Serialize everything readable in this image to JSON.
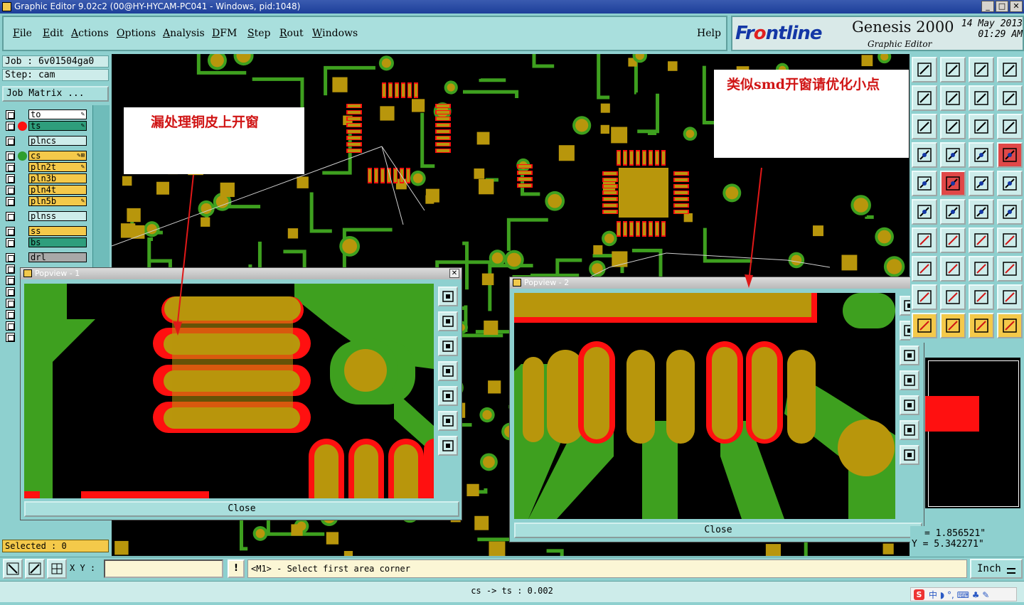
{
  "window": {
    "title": "Graphic Editor 9.02c2 (00@HY-HYCAM-PC041 - Windows, pid:1048)",
    "buttons": [
      "_",
      "□",
      "✕"
    ]
  },
  "menu": {
    "items": [
      "File",
      "Edit",
      "Actions",
      "Options",
      "Analysis",
      "DFM",
      "Step",
      "Rout",
      "Windows"
    ],
    "help": "Help"
  },
  "brand": {
    "logo_a": "Fr",
    "logo_b": "o",
    "logo_c": "ntline",
    "product": "Genesis 2000",
    "subtitle": "Graphic Editor",
    "date": "14 May 2013",
    "time": "01:29 AM"
  },
  "job": {
    "job_line": "Job : 6v01504ga0",
    "step_line": "Step: cam",
    "matrix_button": "Job Matrix ..."
  },
  "layers": [
    {
      "name": "to",
      "color": "#ffffff",
      "dot": "",
      "mark": "✎"
    },
    {
      "name": "ts",
      "color": "#2e9e7c",
      "dot": "#ff1010",
      "mark": "✎"
    },
    {
      "name": "plncs",
      "color": "#cdecea",
      "dot": "",
      "mark": ""
    },
    {
      "name": "cs",
      "color": "#f4c94a",
      "dot": "#2f9e2f",
      "mark": "✎⊞"
    },
    {
      "name": "pln2t",
      "color": "#f4c94a",
      "dot": "",
      "mark": "✎"
    },
    {
      "name": "pln3b",
      "color": "#f4c94a",
      "dot": "",
      "mark": ""
    },
    {
      "name": "pln4t",
      "color": "#f4c94a",
      "dot": "",
      "mark": ""
    },
    {
      "name": "pln5b",
      "color": "#f4c94a",
      "dot": "",
      "mark": "✎"
    },
    {
      "name": "plnss",
      "color": "#cdecea",
      "dot": "",
      "mark": ""
    },
    {
      "name": "ss",
      "color": "#f4c94a",
      "dot": "",
      "mark": ""
    },
    {
      "name": "bs",
      "color": "#2e9e7c",
      "dot": "",
      "mark": ""
    },
    {
      "name": "drl",
      "color": "#a8a8a8",
      "dot": "",
      "mark": ""
    }
  ],
  "selected": "Selected : 0",
  "annotations": {
    "left": "漏处理铜皮上开窗",
    "right": "类似smd开窗请优化小点"
  },
  "popview1": {
    "title": "Popview - 1",
    "close": "Close"
  },
  "popview2": {
    "title": "Popview - 2",
    "close": "Close"
  },
  "coords": {
    "x": "= 1.856521\"",
    "y": "Y = 5.342271\""
  },
  "status": {
    "xy_label": "X Y :",
    "xy_value": "",
    "excl": "!",
    "prompt": "<M1> - Select first area corner",
    "units": "Inch"
  },
  "bottom": {
    "distance": "cs -> ts : 0.002",
    "ime_logo": "S",
    "ime_text": "中 ◗ °, ⌨ ♣ ✎"
  },
  "colors": {
    "copper": "#b8960c",
    "trace": "#3ea01f",
    "mask": "#ff1010",
    "panel": "#8ed0cf"
  }
}
